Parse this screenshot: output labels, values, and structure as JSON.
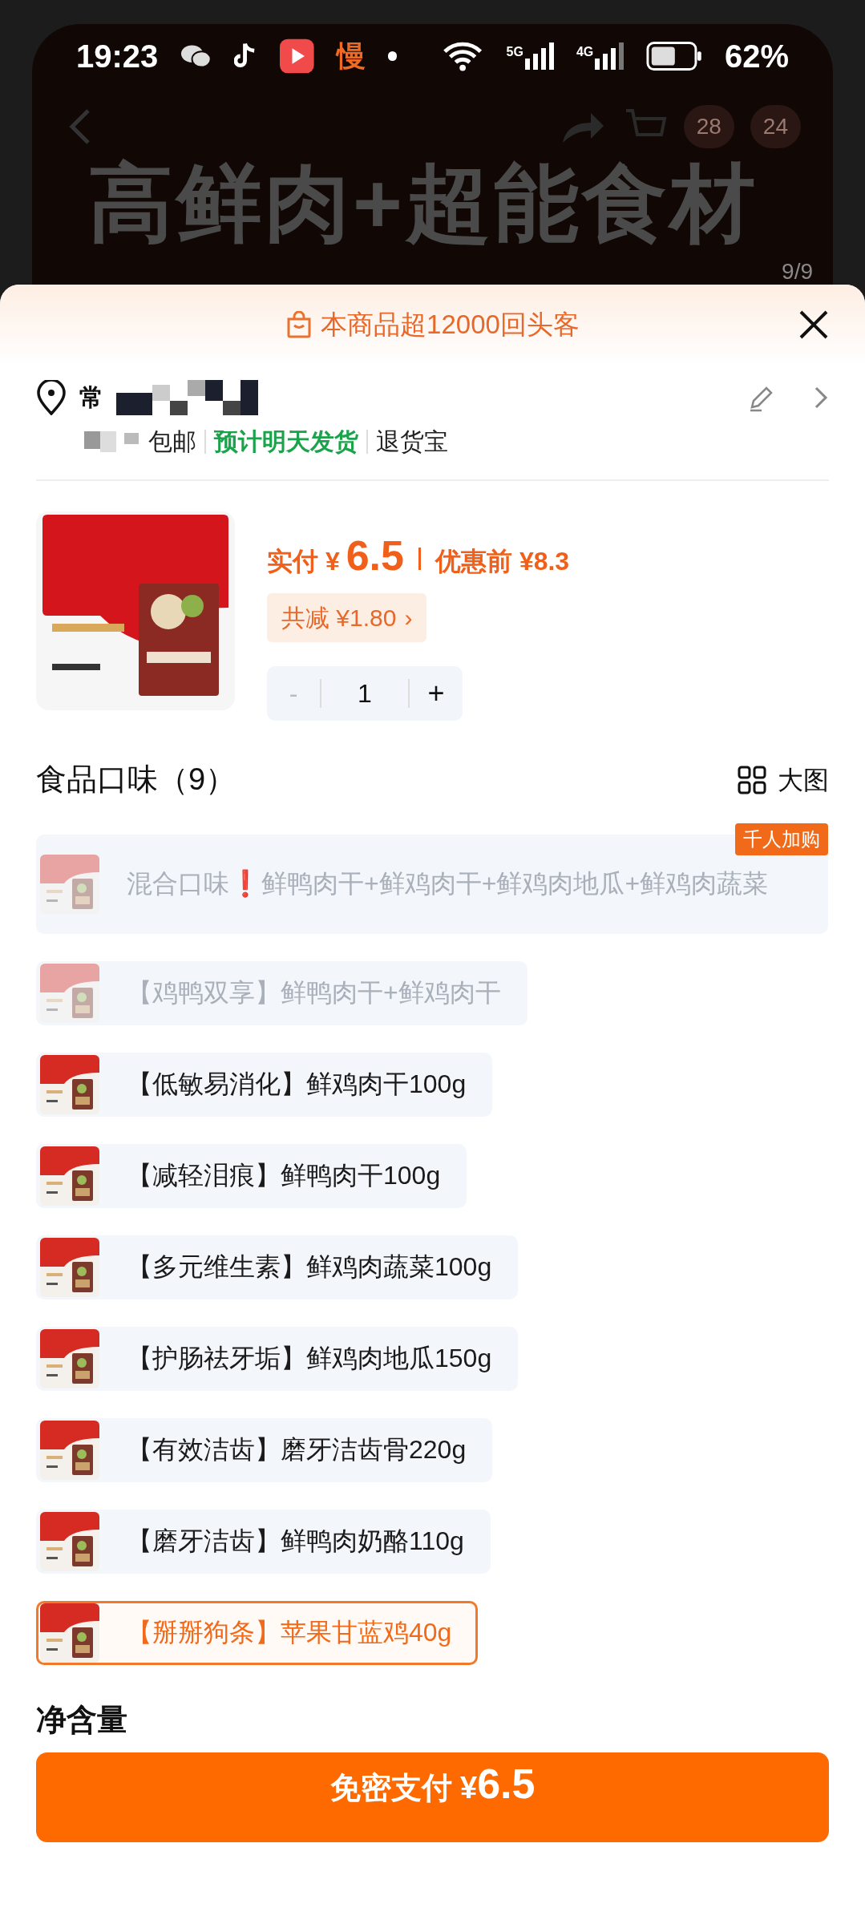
{
  "status_bar": {
    "time": "19:23",
    "app_glyph": "慢",
    "signal_1": "5G",
    "signal_2": "4G",
    "battery": "62%"
  },
  "background_page": {
    "headline": "高鲜肉+超能食材",
    "badges": [
      "28",
      "24"
    ],
    "page_indicator": "9/9"
  },
  "sheet": {
    "banner": "本商品超12000回头客",
    "address": {
      "name": "常",
      "tags": [
        {
          "text": "包邮",
          "kind": "plain"
        },
        {
          "text": "预计明天发货",
          "kind": "green"
        },
        {
          "text": "退货宝",
          "kind": "plain"
        }
      ]
    },
    "product": {
      "paid_label": "实付 ¥",
      "paid_value": "6.5",
      "before_label": "优惠前 ¥8.3",
      "discount": "共减 ¥1.80",
      "discount_caret": "›",
      "quantity": "1",
      "minus": "-",
      "plus": "+",
      "minus_disabled": true
    },
    "flavor_section": {
      "title": "食品口味（9）",
      "view_toggle": "大图"
    },
    "options": [
      {
        "label": "混合口味❗鲜鸭肉干+鲜鸡肉干+鲜鸡肉地瓜+鲜鸡肉蔬菜",
        "disabled": true,
        "selected": false,
        "badge": "千人加购"
      },
      {
        "label": "【鸡鸭双享】鲜鸭肉干+鲜鸡肉干",
        "disabled": true,
        "selected": false
      },
      {
        "label": "【低敏易消化】鲜鸡肉干100g",
        "disabled": false,
        "selected": false
      },
      {
        "label": "【减轻泪痕】鲜鸭肉干100g",
        "disabled": false,
        "selected": false
      },
      {
        "label": "【多元维生素】鲜鸡肉蔬菜100g",
        "disabled": false,
        "selected": false
      },
      {
        "label": "【护肠祛牙垢】鲜鸡肉地瓜150g",
        "disabled": false,
        "selected": false
      },
      {
        "label": "【有效洁齿】磨牙洁齿骨220g",
        "disabled": false,
        "selected": false
      },
      {
        "label": "【磨牙洁齿】鲜鸭肉奶酪110g",
        "disabled": false,
        "selected": false
      },
      {
        "label": "【掰掰狗条】苹果甘蓝鸡40g",
        "disabled": false,
        "selected": true
      }
    ],
    "next_section": "净含量",
    "pay_button": {
      "label": "免密支付 ¥",
      "amount": "6.5"
    }
  }
}
